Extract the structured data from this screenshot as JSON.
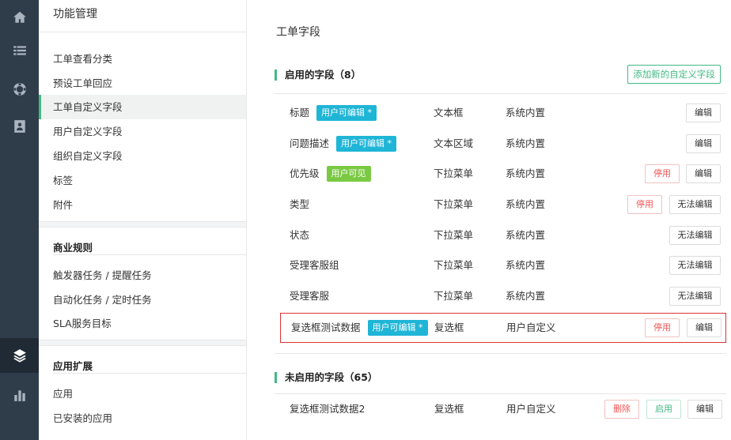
{
  "rail": {
    "icons": [
      "home-icon",
      "list-icon",
      "lifebuoy-icon",
      "contact-card-icon",
      "layers-icon",
      "bar-chart-icon"
    ]
  },
  "subnav": {
    "title": "功能管理",
    "items": [
      "工单查看分类",
      "预设工单回应",
      "工单自定义字段",
      "用户自定义字段",
      "组织自定义字段",
      "标签",
      "附件"
    ],
    "section_business": "商业规则",
    "business_items": [
      "触发器任务 / 提醒任务",
      "自动化任务 / 定时任务",
      "SLA服务目标"
    ],
    "section_ext": "应用扩展",
    "ext_items": [
      "应用",
      "已安装的应用"
    ]
  },
  "main": {
    "title": "工单字段",
    "enabled_heading": "启用的字段（8）",
    "add_button": "添加新的自定义字段",
    "disabled_heading": "未启用的字段（65）",
    "enabled_rows": [
      {
        "name": "标题",
        "tag": "用户可编辑 *",
        "type": "文本框",
        "source": "系统内置",
        "action": "编辑"
      },
      {
        "name": "问题描述",
        "tag": "用户可编辑 *",
        "type": "文本区域",
        "source": "系统内置",
        "action": "编辑"
      },
      {
        "name": "优先级",
        "tag": "用户可见",
        "type": "下拉菜单",
        "source": "系统内置",
        "disable": "停用",
        "action": "编辑"
      },
      {
        "name": "类型",
        "type": "下拉菜单",
        "source": "系统内置",
        "disable": "停用",
        "action": "无法编辑"
      },
      {
        "name": "状态",
        "type": "下拉菜单",
        "source": "系统内置",
        "action": "无法编辑"
      },
      {
        "name": "受理客服组",
        "type": "下拉菜单",
        "source": "系统内置",
        "action": "无法编辑"
      },
      {
        "name": "受理客服",
        "type": "下拉菜单",
        "source": "系统内置",
        "action": "无法编辑"
      },
      {
        "name": "复选框测试数据",
        "tag": "用户可编辑 *",
        "type": "复选框",
        "source": "用户自定义",
        "disable": "停用",
        "action": "编辑"
      }
    ],
    "disabled_rows": [
      {
        "name": "复选框测试数据2",
        "type": "复选框",
        "source": "用户自定义",
        "delete": "删除",
        "enable": "启用",
        "action": "编辑"
      }
    ]
  },
  "colors": {
    "accent": "#42b983",
    "tag_blue": "#1fb5d6",
    "tag_green": "#7ac943",
    "rail": "#2f3d4b",
    "highlight": "#dd3333"
  }
}
